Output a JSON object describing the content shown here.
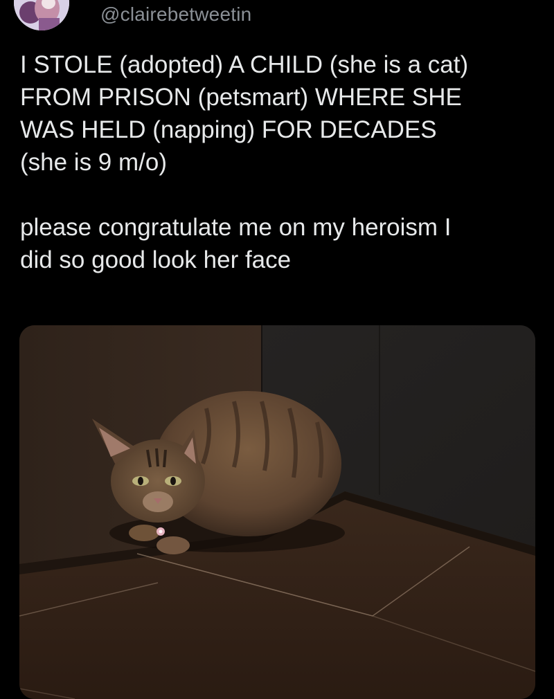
{
  "tweet": {
    "handle": "@clairebetweetin",
    "paragraph_1": "I STOLE (adopted) A CHILD (she is a cat)\nFROM PRISON (petsmart) WHERE SHE\nWAS HELD (napping) FOR DECADES\n(she is 9 m/o)",
    "paragraph_2": "please congratulate me on my heroism I\ndid so good look her face"
  },
  "colors": {
    "background": "#000000",
    "text": "#e7e9ea",
    "handle": "#8b9096"
  },
  "media": {
    "subject": "tabby cat crouching in a corner on a dark tiled floor"
  }
}
